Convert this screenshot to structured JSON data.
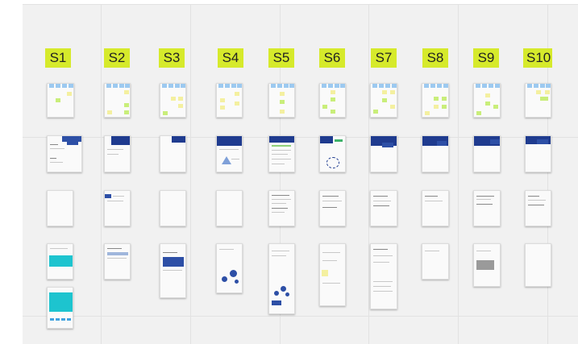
{
  "sprints": [
    {
      "id": "s1",
      "label": "S1"
    },
    {
      "id": "s2",
      "label": "S2"
    },
    {
      "id": "s3",
      "label": "S3"
    },
    {
      "id": "s4",
      "label": "S4"
    },
    {
      "id": "s5",
      "label": "S5"
    },
    {
      "id": "s6",
      "label": "S6"
    },
    {
      "id": "s7",
      "label": "S7"
    },
    {
      "id": "s8",
      "label": "S8"
    },
    {
      "id": "s9",
      "label": "S9"
    },
    {
      "id": "s10",
      "label": "S10"
    }
  ],
  "colors": {
    "label_bg": "#d6ea2b",
    "board_bg": "#f1f1f1",
    "card_bg": "#fafafa",
    "tab": "#9cc9f0",
    "sticky_yellow": "#f4f0a0",
    "sticky_green": "#c9ee7a",
    "navy": "#1f3b8f",
    "cyan": "#1dc4cf"
  }
}
